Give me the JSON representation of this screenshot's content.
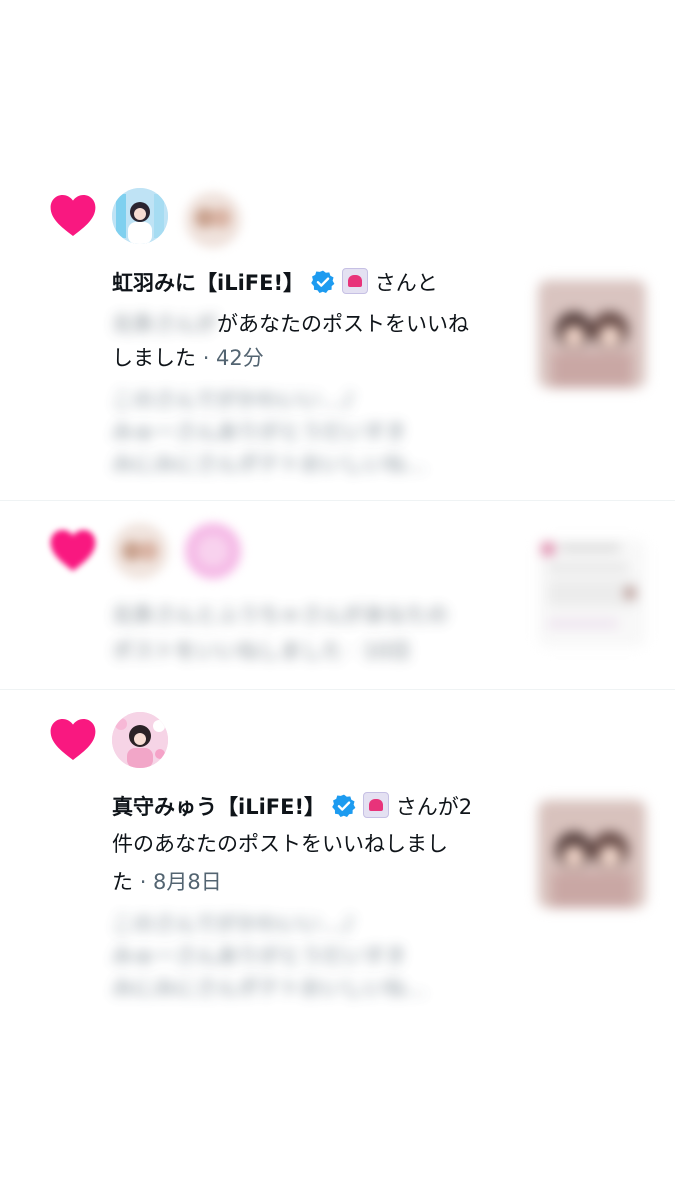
{
  "notifications": [
    {
      "name": "虹羽みに【iLiFE!】",
      "rest": "さんと",
      "body_blur": "北条さんが",
      "body": "があなたのポストをいいね",
      "body2": "しました",
      "time": "· 42分",
      "preview": [
        "このさんでがかわいい…♪",
        "みゅーさんありがとうだいすき",
        "みにみにさんポテトおいしいね…"
      ]
    },
    {
      "body_blur_1": "北条さんとふうちゃさんがあなたの",
      "body_blur_2": "ポストをいいねしました · 10日"
    },
    {
      "name": "真守みゅう【iLiFE!】",
      "rest": "さんが2",
      "body": "件のあなたのポストをいいねしまし",
      "body2": "た",
      "time": "· 8月8日",
      "preview": [
        "このさんでがかわいい…♪",
        "みゅーさんありがとうだいすき",
        "みにみにさんポテトおいしいね…"
      ]
    }
  ],
  "colors": {
    "heart": "#f91880",
    "verified": "#1d9bf0",
    "muted": "#536471"
  },
  "icons": {
    "like": "heart-icon",
    "verified": "verified-badge-icon",
    "app": "app-badge-icon"
  }
}
